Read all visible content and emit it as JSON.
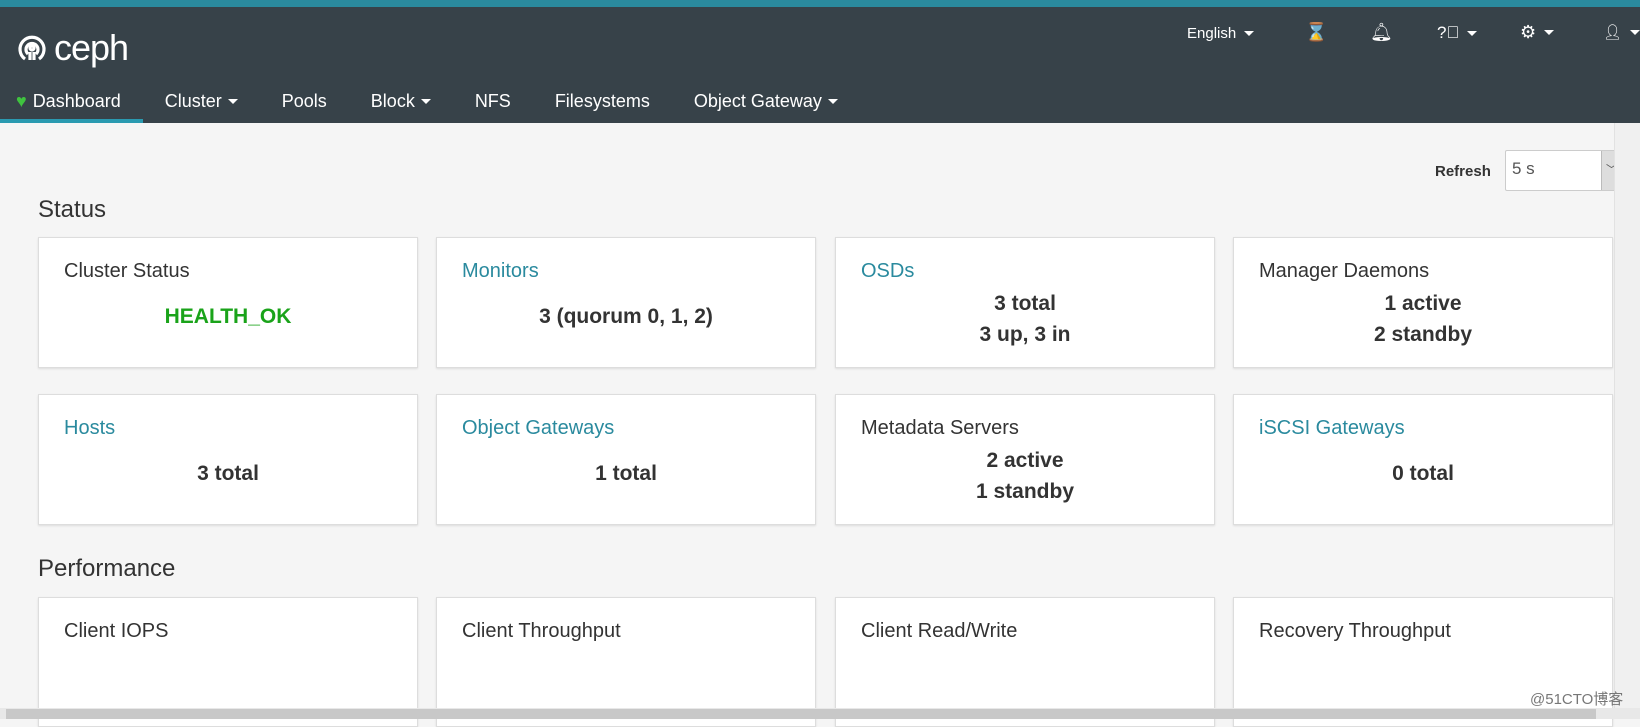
{
  "brand": "ceph",
  "header": {
    "language": "English",
    "icons": [
      "hourglass-icon",
      "bell-icon",
      "help-icon",
      "gear-icon",
      "user-icon"
    ]
  },
  "nav": [
    {
      "label": "Dashboard",
      "active": true
    },
    {
      "label": "Cluster",
      "dropdown": true
    },
    {
      "label": "Pools"
    },
    {
      "label": "Block",
      "dropdown": true
    },
    {
      "label": "NFS"
    },
    {
      "label": "Filesystems"
    },
    {
      "label": "Object Gateway",
      "dropdown": true
    }
  ],
  "refresh": {
    "label": "Refresh",
    "value": "5 s"
  },
  "status": {
    "heading": "Status",
    "cards": [
      {
        "title": "Cluster Status",
        "link": false,
        "values": [
          "HEALTH_OK"
        ]
      },
      {
        "title": "Monitors",
        "link": true,
        "values": [
          "3 (quorum 0, 1, 2)"
        ]
      },
      {
        "title": "OSDs",
        "link": true,
        "values": [
          "3 total",
          "3 up, 3 in"
        ]
      },
      {
        "title": "Manager Daemons",
        "link": false,
        "values": [
          "1 active",
          "2 standby"
        ]
      },
      {
        "title": "Hosts",
        "link": true,
        "values": [
          "3 total"
        ]
      },
      {
        "title": "Object Gateways",
        "link": true,
        "values": [
          "1 total"
        ]
      },
      {
        "title": "Metadata Servers",
        "link": false,
        "values": [
          "2 active",
          "1 standby"
        ]
      },
      {
        "title": "iSCSI Gateways",
        "link": true,
        "values": [
          "0 total"
        ]
      }
    ]
  },
  "performance": {
    "heading": "Performance",
    "cards": [
      {
        "title": "Client IOPS"
      },
      {
        "title": "Client Throughput"
      },
      {
        "title": "Client Read/Write"
      },
      {
        "title": "Recovery Throughput"
      }
    ]
  },
  "colors": {
    "accent": "#2a8a9e",
    "navbar": "#374249",
    "health_ok": "#1aa31a"
  },
  "watermark": "@51CTO博客"
}
